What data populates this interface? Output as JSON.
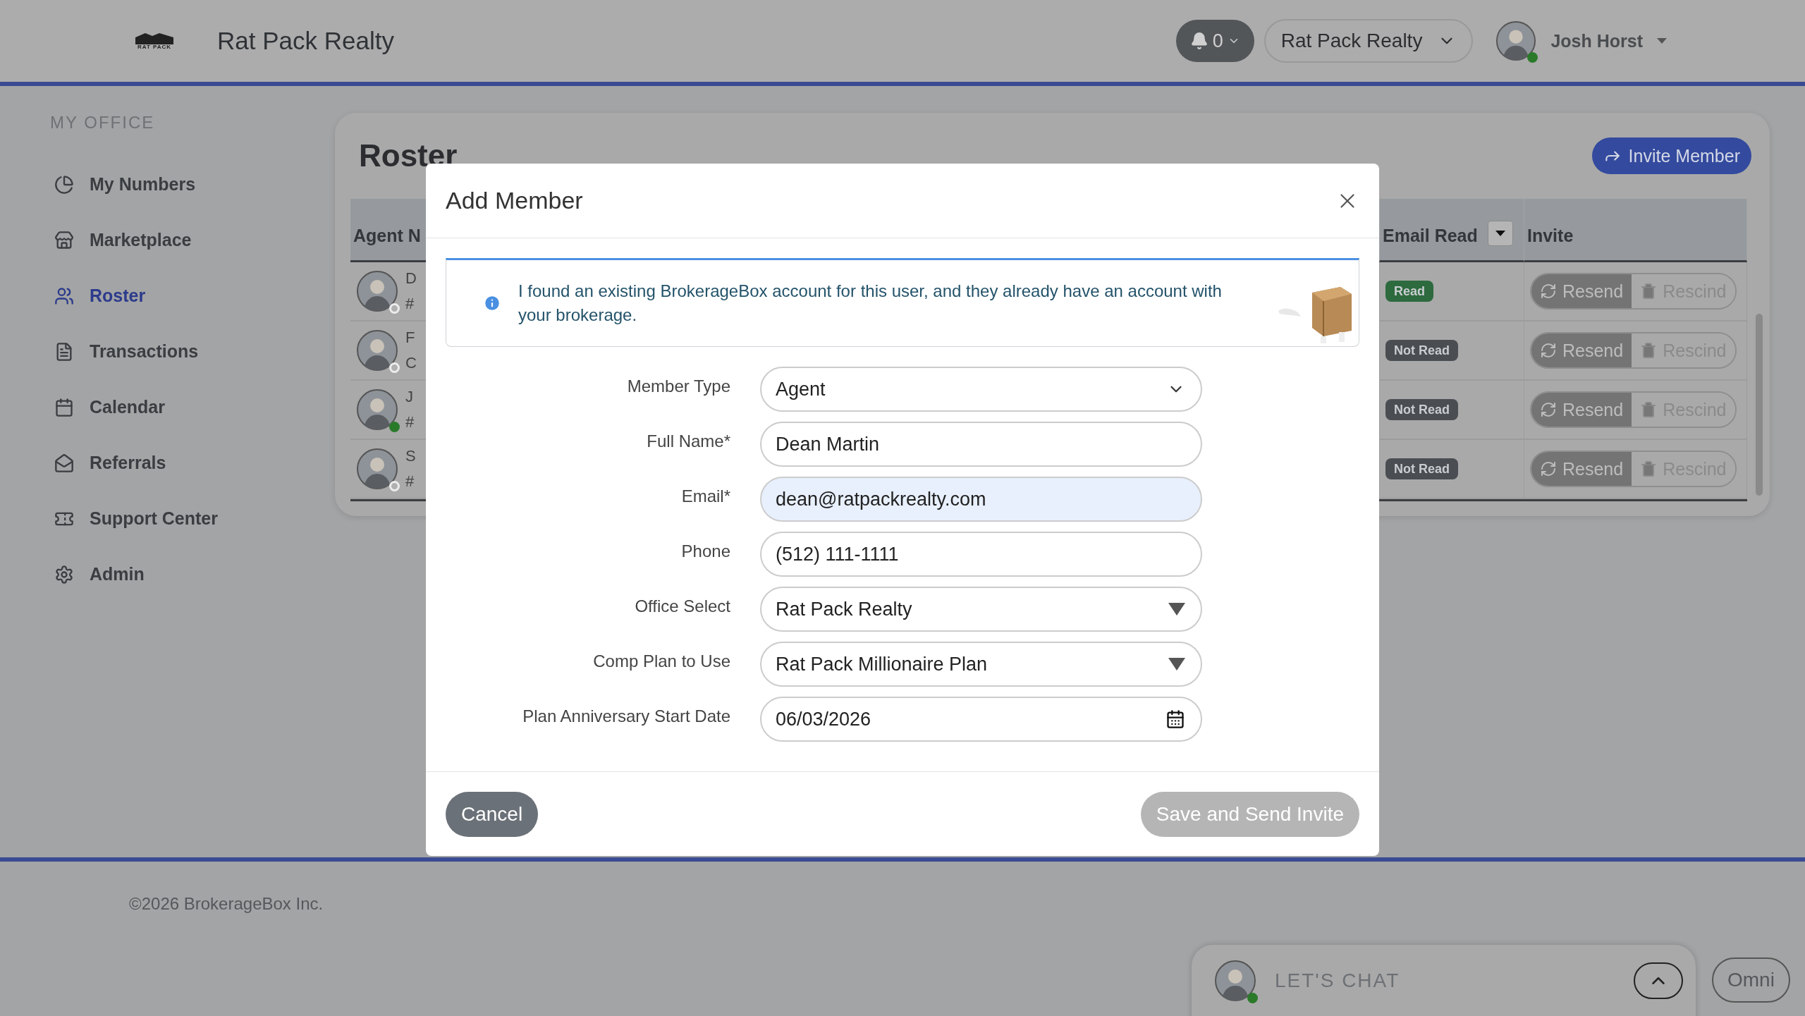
{
  "header": {
    "logo_text": "RAT PACK",
    "title": "Rat Pack Realty",
    "notifications": {
      "count": "0"
    },
    "office_select": {
      "value": "Rat Pack Realty"
    },
    "user": {
      "name": "Josh Horst",
      "online": true
    }
  },
  "sidebar": {
    "heading": "MY OFFICE",
    "items": [
      {
        "label": "My Numbers",
        "selected": false
      },
      {
        "label": "Marketplace",
        "selected": false
      },
      {
        "label": "Roster",
        "selected": true
      },
      {
        "label": "Transactions",
        "selected": false
      },
      {
        "label": "Calendar",
        "selected": false
      },
      {
        "label": "Referrals",
        "selected": false
      },
      {
        "label": "Support Center",
        "selected": false
      },
      {
        "label": "Admin",
        "selected": false
      }
    ]
  },
  "roster": {
    "title": "Roster",
    "invite_button": "Invite Member",
    "table": {
      "columns": [
        "Agent N",
        "Email Read",
        "Invite"
      ],
      "rows": [
        {
          "name": "D",
          "sub": "#",
          "online": false,
          "email_read": "Read",
          "read": true,
          "actions": [
            "Resend",
            "Rescind"
          ]
        },
        {
          "name": "F",
          "sub": "C",
          "online": false,
          "email_read": "Not Read",
          "read": false,
          "actions": [
            "Resend",
            "Rescind"
          ]
        },
        {
          "name": "J",
          "sub": "#",
          "online": true,
          "email_read": "Not Read",
          "read": false,
          "actions": [
            "Resend",
            "Rescind"
          ]
        },
        {
          "name": "S",
          "sub": "#",
          "online": false,
          "email_read": "Not Read",
          "read": false,
          "actions": [
            "Resend",
            "Rescind"
          ]
        }
      ]
    }
  },
  "modal": {
    "title": "Add Member",
    "alert": "I found an existing BrokerageBox account for this user, and they already have an account with your brokerage.",
    "fields": [
      {
        "label": "Member Type",
        "kind": "select",
        "value": "Agent",
        "highlighted": false
      },
      {
        "label": "Full Name*",
        "kind": "text",
        "value": "Dean Martin",
        "highlighted": false
      },
      {
        "label": "Email*",
        "kind": "text",
        "value": "dean@ratpackrealty.com",
        "highlighted": true
      },
      {
        "label": "Phone",
        "kind": "text",
        "value": "(512) 111-1111",
        "highlighted": false
      },
      {
        "label": "Office Select",
        "kind": "dropdown",
        "value": "Rat Pack Realty",
        "highlighted": false
      },
      {
        "label": "Comp Plan to Use",
        "kind": "dropdown",
        "value": "Rat Pack Millionaire Plan",
        "highlighted": false
      },
      {
        "label": "Plan Anniversary Start Date",
        "kind": "date",
        "value": "06/03/2026",
        "highlighted": false
      }
    ],
    "cancel_button": "Cancel",
    "save_button": {
      "label": "Save and Send Invite",
      "disabled": true
    }
  },
  "footer": {
    "copyright": "©2026 BrokerageBox Inc."
  },
  "chat": {
    "label": "LET'S CHAT",
    "online": true
  },
  "omni_button": "Omni"
}
